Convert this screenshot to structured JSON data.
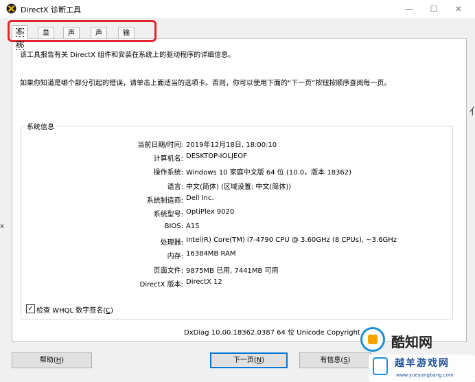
{
  "window": {
    "title": "DirectX 诊断工具"
  },
  "window_controls": {
    "minimize": "—",
    "maximize": "☐",
    "close": "✕"
  },
  "tabs": [
    {
      "label": "系统",
      "active": true
    },
    {
      "label": "显示",
      "active": false
    },
    {
      "label": "声音 1",
      "active": false
    },
    {
      "label": "声音 2",
      "active": false
    },
    {
      "label": "输入",
      "active": false
    }
  ],
  "intro": {
    "line1": "该工具报告有关 DirectX 组件和安装在系统上的驱动程序的详细信息。",
    "line2": "如果你知道是哪个部分引起的错误，请单击上面适当的选项卡。否则，你可以使用下面的“下一页”按钮按顺序查阅每一页。"
  },
  "system_info": {
    "title": "系统信息",
    "rows": [
      {
        "label": "当前日期/时间:",
        "value": "2019年12月18日, 18:00:10"
      },
      {
        "label": "计算机名:",
        "value": "DESKTOP-IOLJEOF"
      },
      {
        "label": "操作系统:",
        "value": "Windows 10 家庭中文版 64 位 (10.0，版本 18362)"
      },
      {
        "label": "语言:",
        "value": "中文(简体) (区域设置: 中文(简体))"
      },
      {
        "label": "系统制造商:",
        "value": "Dell Inc."
      },
      {
        "label": "系统型号:",
        "value": "OptiPlex 9020"
      },
      {
        "label": "BIOS:",
        "value": "A15"
      },
      {
        "label": "处理器:",
        "value": "Intel(R) Core(TM) i7-4790 CPU @ 3.60GHz (8 CPUs), ~3.6GHz"
      },
      {
        "label": "内存:",
        "value": "16384MB RAM"
      },
      {
        "label": "页面文件:",
        "value": "9875MB 已用, 7441MB 可用"
      },
      {
        "label": "DirectX 版本:",
        "value": "DirectX 12"
      }
    ]
  },
  "whql": {
    "label": "检查 WHQL 数字签名(",
    "accel": "C",
    "label_end": ")",
    "checked": true,
    "check_glyph": "✓"
  },
  "footer_text": "DxDiag 10.00.18362.0387 64 位 Unicode  Copyright ©",
  "buttons": {
    "help": {
      "label": "帮助(",
      "accel": "H",
      "end": ")"
    },
    "next": {
      "label": "下一页(",
      "accel": "N",
      "end": ")"
    },
    "save": {
      "label": "有信息(",
      "accel": "S",
      "end": ")"
    }
  },
  "watermark": {
    "brand": "酷知网",
    "badge_title": "越羊游戏网",
    "url": "www.yueyangbang.com"
  },
  "edge_glyphs": {
    "right": "亻",
    "left": "x"
  },
  "colors": {
    "highlight": "#e0262e",
    "accent": "#0078d7"
  }
}
